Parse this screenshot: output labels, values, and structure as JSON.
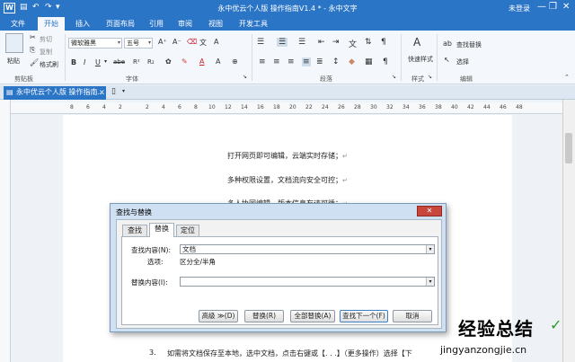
{
  "window": {
    "title": "永中优云个人版 操作指南V1.4 * - 永中文字",
    "login": "未登录",
    "logo": "W"
  },
  "ribbon_tabs": [
    "文件",
    "开始",
    "插入",
    "页面布局",
    "引用",
    "审阅",
    "视图",
    "开发工具"
  ],
  "ribbon": {
    "clipboard": {
      "cut": "剪切",
      "copy": "复制",
      "format_painter": "格式刷",
      "paste": "粘贴",
      "label": "剪贴板"
    },
    "font": {
      "family": "微软雅黑",
      "size": "五号",
      "label": "字体",
      "bold": "B",
      "italic": "I",
      "underline": "U",
      "strike": "abe",
      "superscript": "R²",
      "subscript": "R₂"
    },
    "paragraph": {
      "label": "段落"
    },
    "style": {
      "quick_style": "快速样式",
      "label": "样式"
    },
    "edit": {
      "find_replace": "查找替换",
      "select": "选择",
      "label": "编辑"
    }
  },
  "doc_tab": {
    "label": "永中优云个人版 操作指南..."
  },
  "ruler": {
    "numbers": [
      "8",
      "6",
      "4",
      "2",
      "",
      "2",
      "4",
      "6",
      "8",
      "10",
      "12",
      "14",
      "16",
      "18",
      "20",
      "22",
      "24",
      "26",
      "28",
      "30",
      "32",
      "34",
      "36",
      "38",
      "40",
      "42",
      "44",
      "46",
      "48"
    ]
  },
  "document": {
    "lines": [
      "打开网页即可编辑，云端实时存储；",
      "多种权限设置，文档流向安全可控；",
      "多人协同编辑，版本信息有迹可循；"
    ],
    "step": {
      "number": "3.",
      "text": "如需将文档保存至本地，选中文档，点击右键或【. . .】（更多操作）选择【下"
    }
  },
  "dialog": {
    "title": "查找与替换",
    "tabs": [
      "查找",
      "替换",
      "定位"
    ],
    "active_tab": "替换",
    "find_label": "查找内容(N):",
    "find_value": "文档",
    "options_label": "选项:",
    "options_value": "区分全/半角",
    "replace_label": "替换内容(I):",
    "replace_value": "",
    "buttons": {
      "advanced": "高级 ≫(D)",
      "replace": "替换(R)",
      "replace_all": "全部替换(A)",
      "find_next": "查找下一个(F)",
      "cancel": "取消"
    }
  },
  "watermark": {
    "title": "经验总结",
    "url": "jingyanzongjie.cn"
  },
  "colors": {
    "accent": "#2b75c7",
    "ribbon_bg": "#f4f8fc",
    "dialog_bg": "#cfe0f2"
  }
}
